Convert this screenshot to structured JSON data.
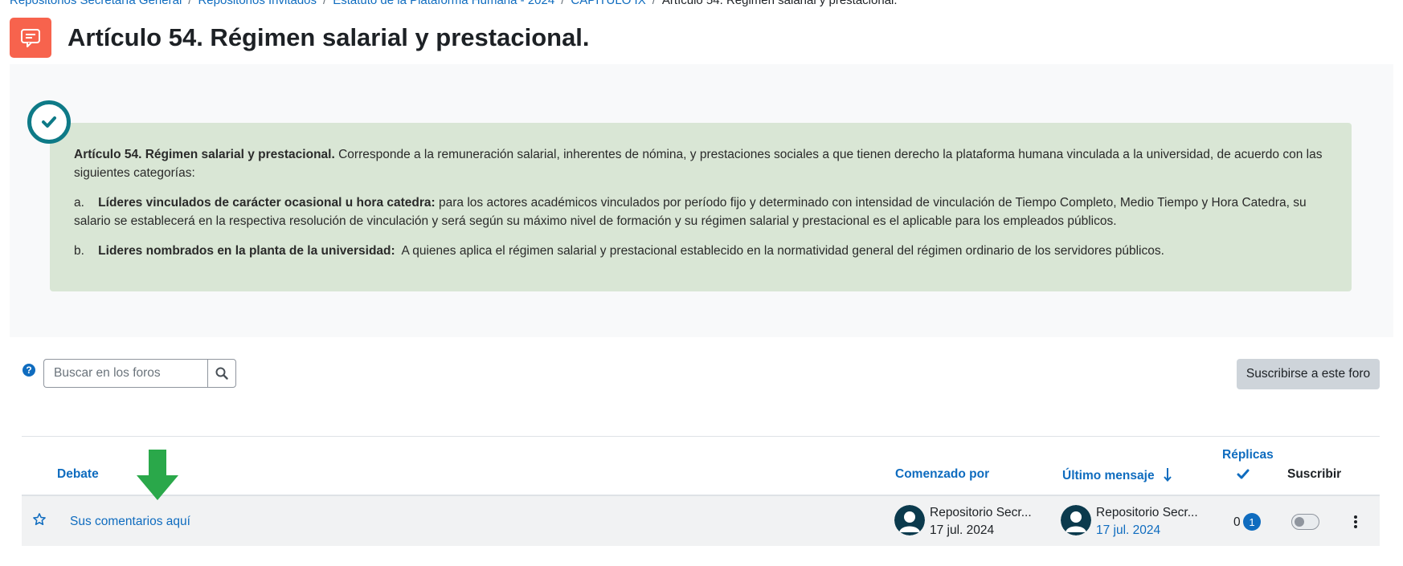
{
  "breadcrumb": {
    "items": [
      "Repositorios Secretaría General",
      "Repositorios Invitados",
      "Estatuto de la Plataforma Humana - 2024",
      "CAPÍTULO IX"
    ],
    "current": "Artículo 54. Régimen salarial y prestacional.",
    "separator": "/"
  },
  "page": {
    "title": "Artículo 54. Régimen salarial y prestacional.",
    "icon": "forum-icon",
    "accent_color": "#f7634d"
  },
  "intro": {
    "badge_icon": "check-circle-icon",
    "p1_bold": "Artículo 54. Régimen salarial y prestacional.",
    "p1_text": " Corresponde a la remuneración salarial, inherentes de nómina, y prestaciones sociales a que tienen derecho la plataforma humana vinculada a la universidad, de acuerdo con las siguientes categorías:",
    "item_a_marker": "a.",
    "item_a_bold": "Líderes vinculados de carácter ocasional u hora catedra:",
    "item_a_text": " para los actores académicos vinculados por período fijo y determinado con intensidad de vinculación de Tiempo Completo, Medio Tiempo y Hora Catedra, su salario se establecerá en la respectiva resolución de vinculación y será según su máximo nivel de formación y su régimen salarial y prestacional es el aplicable para los empleados públicos.",
    "item_b_marker": "b.",
    "item_b_bold": "Lideres nombrados en la planta de la universidad:",
    "item_b_text": "  A quienes aplica el régimen salarial y prestacional establecido en la normatividad general del régimen ordinario de los servidores públicos."
  },
  "search": {
    "placeholder": "Buscar en los foros",
    "value": "",
    "help_icon": "question-circle-icon",
    "button_icon": "search-icon"
  },
  "subscribe_forum_label": "Suscribirse a este foro",
  "table": {
    "headers": {
      "discussion": "Debate",
      "started_by": "Comenzado por",
      "last_post": "Último mensaje",
      "replies": "Réplicas",
      "subscribe": "Suscribir"
    },
    "rows": [
      {
        "title": "Sus comentarios aquí",
        "started_by_name": "Repositorio Secr...",
        "started_by_date": "17 jul. 2024",
        "last_post_name": "Repositorio Secr...",
        "last_post_date": "17 jul. 2024",
        "replies": "0",
        "unread": "1",
        "subscribed": false
      }
    ]
  },
  "colors": {
    "link": "#0f6cbf",
    "note_bg": "#d9e6d5",
    "badge_ring": "#0e7a87",
    "arrow": "#2aa84a"
  }
}
